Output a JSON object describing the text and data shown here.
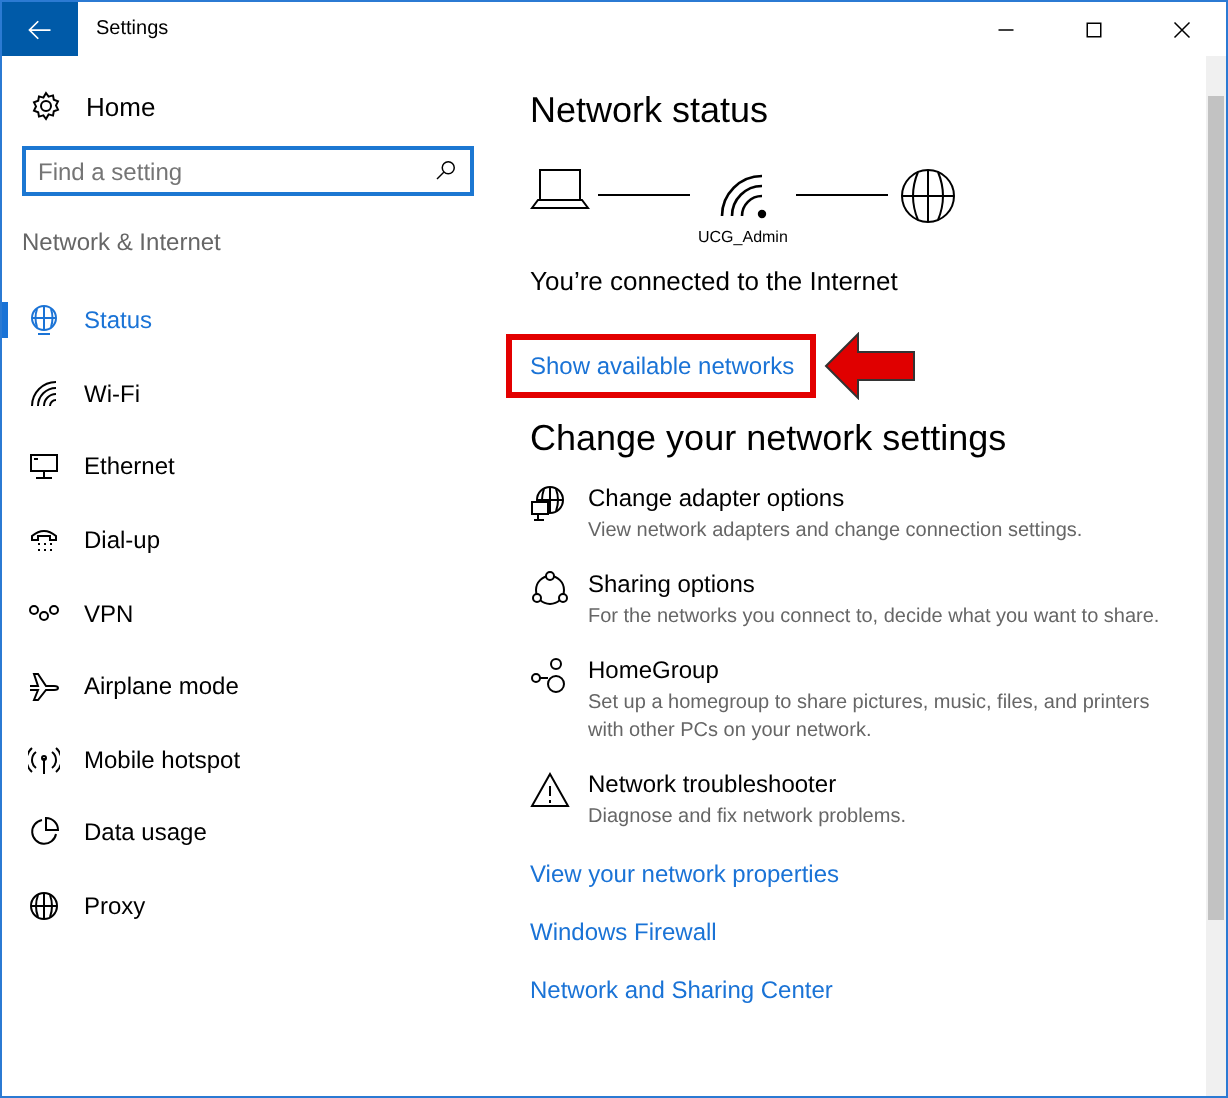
{
  "window": {
    "title": "Settings"
  },
  "sidebar": {
    "home": "Home",
    "search": {
      "placeholder": "Find a setting"
    },
    "section": "Network & Internet",
    "items": [
      {
        "label": "Status",
        "selected": true
      },
      {
        "label": "Wi-Fi",
        "selected": false
      },
      {
        "label": "Ethernet",
        "selected": false
      },
      {
        "label": "Dial-up",
        "selected": false
      },
      {
        "label": "VPN",
        "selected": false
      },
      {
        "label": "Airplane mode",
        "selected": false
      },
      {
        "label": "Mobile hotspot",
        "selected": false
      },
      {
        "label": "Data usage",
        "selected": false
      },
      {
        "label": "Proxy",
        "selected": false
      }
    ]
  },
  "main": {
    "title": "Network status",
    "network_name": "UCG_Admin",
    "status": "You’re connected to the Internet",
    "highlighted_link": "Show available networks",
    "settings_title": "Change your network settings",
    "settings": [
      {
        "title": "Change adapter options",
        "description": "View network adapters and change connection settings."
      },
      {
        "title": "Sharing options",
        "description": "For the networks you connect to, decide what you want to share."
      },
      {
        "title": "HomeGroup",
        "description": "Set up a homegroup to share pictures, music, files, and printers with other PCs on your network."
      },
      {
        "title": "Network troubleshooter",
        "description": "Diagnose and fix network problems."
      }
    ],
    "links": [
      "View your network properties",
      "Windows Firewall",
      "Network and Sharing Center"
    ]
  }
}
